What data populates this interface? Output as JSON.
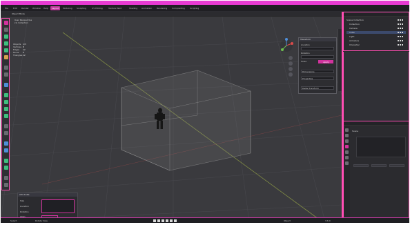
{
  "window": {
    "title": ""
  },
  "menubar": {
    "items": [
      "File",
      "Edit",
      "Render",
      "Window",
      "Help",
      "Layout",
      "Modeling",
      "Sculpting",
      "UV Editing",
      "Texture Paint",
      "Shading",
      "Animation",
      "Rendering",
      "Compositing",
      "Scripting"
    ],
    "active_index": 5
  },
  "viewport": {
    "mode": "Object Mode",
    "view_label": "User Perspective",
    "collection": "(1) Collection",
    "stats": [
      {
        "label": "Objects",
        "value": "1/3"
      },
      {
        "label": "Vertices",
        "value": "8"
      },
      {
        "label": "Edges",
        "value": "12"
      },
      {
        "label": "Faces",
        "value": "6"
      },
      {
        "label": "Triangles",
        "value": "12"
      }
    ]
  },
  "n_panel": {
    "title": "Transform",
    "fields": [
      "Location",
      "Rotation",
      "Scale"
    ],
    "button": "Apply",
    "more": [
      "Dimensions",
      "Properties",
      "Delta Transform"
    ]
  },
  "operator_panel": {
    "title": "Add Cube",
    "labels": [
      "Size",
      "Location",
      "Rotation",
      "Align"
    ]
  },
  "outliner": {
    "rows": [
      {
        "label": "Scene Collection",
        "selected": false
      },
      {
        "label": "Collection",
        "selected": false
      },
      {
        "label": "Camera",
        "selected": false
      },
      {
        "label": "Cube",
        "selected": true
      },
      {
        "label": "Light",
        "selected": false
      },
      {
        "label": "Armature",
        "selected": false
      },
      {
        "label": "Character",
        "selected": false
      }
    ]
  },
  "properties": {
    "path": "Scene",
    "mid": "",
    "buttons": [
      "",
      "",
      ""
    ]
  },
  "statusbar": {
    "left": "Select",
    "mid": "Rotate View",
    "right": "Object",
    "version": "3.6.0"
  },
  "colors": {
    "accent": "#d2339e",
    "title_bar": "#e83bd3",
    "border": "#ff4db3",
    "viewport_bg": "#3a3a3e"
  }
}
